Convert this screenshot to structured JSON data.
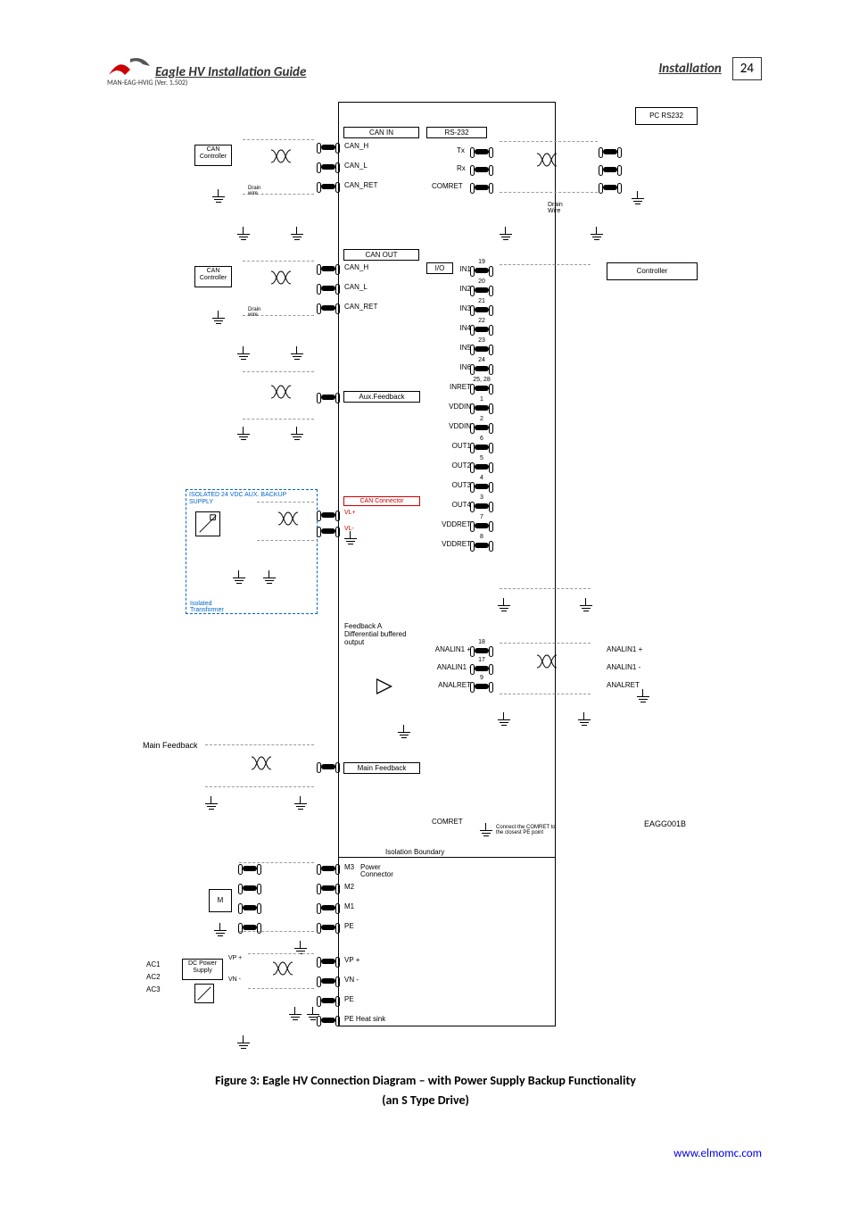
{
  "header": {
    "title": "Eagle HV Installation Guide",
    "section": "Installation",
    "page": "24",
    "version": "MAN-EAG-HVIG (Ver. 1.502)"
  },
  "diagram": {
    "blocks": {
      "pc_rs232": "PC RS232",
      "controller": "Controller",
      "can_controller_1": "CAN Controller",
      "can_controller_2": "CAN Controller",
      "main_feedback_ext": "Main Feedback",
      "motor": "M",
      "dc_power": "DC Power Supply",
      "ac1": "AC1",
      "ac2": "AC2",
      "ac3": "AC3",
      "vp_plus_ext": "VP +",
      "vn_minus_ext": "VN -"
    },
    "subboxes": {
      "can_in": "CAN IN",
      "can_out": "CAN OUT",
      "rs232": "RS-232",
      "io": "I/O",
      "aux_feedback": "Aux.Feedback",
      "can_connector": "CAN Connector",
      "feedback_a": "Feedback A Differential buffered output",
      "main_feedback": "Main Feedback",
      "power_connector": "Power Connector",
      "isolation_boundary": "Isolation Boundary"
    },
    "rs232_pins": {
      "tx": "Tx",
      "rx": "Rx",
      "comret": "COMRET"
    },
    "can_pins": {
      "can_h": "CAN_H",
      "can_l": "CAN_L",
      "can_ret": "CAN_RET"
    },
    "io_pins": [
      {
        "pin": "19",
        "label": "IN1"
      },
      {
        "pin": "20",
        "label": "IN2"
      },
      {
        "pin": "21",
        "label": "IN3"
      },
      {
        "pin": "22",
        "label": "IN4"
      },
      {
        "pin": "23",
        "label": "IN5"
      },
      {
        "pin": "24",
        "label": "IN6"
      },
      {
        "pin": "25, 28",
        "label": "INRET"
      },
      {
        "pin": "1",
        "label": "VDDIN"
      },
      {
        "pin": "2",
        "label": "VDDIN"
      },
      {
        "pin": "6",
        "label": "OUT1"
      },
      {
        "pin": "5",
        "label": "OUT2"
      },
      {
        "pin": "4",
        "label": "OUT3"
      },
      {
        "pin": "3",
        "label": "OUT4"
      },
      {
        "pin": "7",
        "label": "VDDRET"
      },
      {
        "pin": "8",
        "label": "VDDRET"
      }
    ],
    "anal_pins": [
      {
        "pin": "18",
        "label": "ANALIN1 +",
        "ext": "ANALIN1 +"
      },
      {
        "pin": "17",
        "label": "ANALIN1 -",
        "ext": "ANALIN1 -"
      },
      {
        "pin": "9",
        "label": "ANALRET",
        "ext": "ANALRET"
      }
    ],
    "aux_supply": {
      "title": "ISOLATED 24 VDC AUX. BACKUP SUPPLY",
      "vl_plus": "VL+",
      "vl_minus": "VL-",
      "transformer": "Isolated Transformer"
    },
    "power_pins": {
      "m3": "M3",
      "m2": "M2",
      "m1": "M1",
      "pe1": "PE",
      "vp_plus": "VP +",
      "vn_minus": "VN -",
      "pe2": "PE",
      "pe_heatsink": "PE  Heat sink"
    },
    "notes": {
      "drain_wire": "Drain Wire",
      "drain_wire2": "Drain wire",
      "comret_note": "Connect the COMRET to the closest PE point",
      "comret2": "COMRET",
      "eagg": "EAGG001B"
    }
  },
  "caption": {
    "line1": "Figure 3: Eagle HV Connection Diagram – with Power Supply Backup Functionality",
    "line2": "(an S Type Drive)"
  },
  "footer_url": "www.elmomc.com"
}
